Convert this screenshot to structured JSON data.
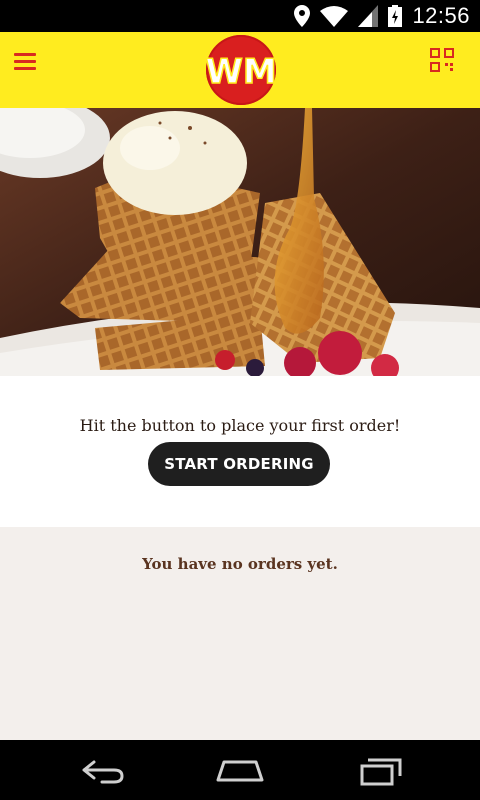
{
  "status_bar": {
    "time": "12:56"
  },
  "header": {
    "logo_text": "WM"
  },
  "hero": {
    "image_alt": ""
  },
  "main": {
    "prompt": "Hit the button to place your first order!",
    "start_button": "START ORDERING"
  },
  "orders": {
    "empty_text": "You have no orders yet."
  },
  "colors": {
    "appbar": "#ffec1f",
    "accent": "#d82a20",
    "button": "#1f1f1f",
    "orders_bg": "#f3efec"
  }
}
